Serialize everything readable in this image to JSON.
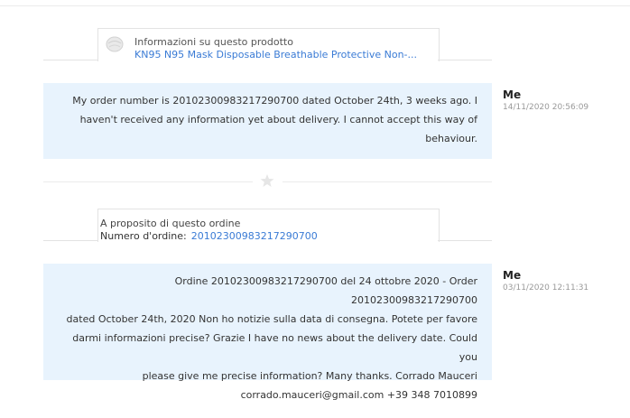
{
  "product_card": {
    "label": "Informazioni su questo prodotto",
    "link": "KN95 N95 Mask Disposable Breathable Protective Non-...",
    "thumbnail_icon": "mask-product-icon"
  },
  "messages": [
    {
      "sender": "Me",
      "timestamp": "14/11/2020 20:56:09",
      "lines": [
        "My order number is 20102300983217290700 dated October 24th, 3 weeks ago. I",
        "haven't received any information yet about delivery. I cannot accept this way of",
        "behaviour."
      ]
    },
    {
      "sender": "Me",
      "timestamp": "03/11/2020 12:11:31",
      "lines": [
        "Ordine 20102300983217290700 del 24 ottobre 2020 - Order 20102300983217290700",
        "dated October 24th, 2020 Non ho notizie sulla data di consegna. Potete per favore",
        "darmi informazioni precise? Grazie I have no news about the delivery date. Could you",
        "please give me precise information? Many thanks. Corrado Mauceri",
        "corrado.mauceri@gmail.com +39 348 7010899"
      ]
    }
  ],
  "order_card": {
    "label": "A proposito di questo ordine",
    "order_number_label": "Numero d'ordine:",
    "order_number": "20102300983217290700"
  },
  "divider": {
    "icon": "star-icon"
  },
  "colors": {
    "bubble_bg": "#e8f3fd",
    "link": "#3a7bd5",
    "timestamp": "#999999"
  }
}
